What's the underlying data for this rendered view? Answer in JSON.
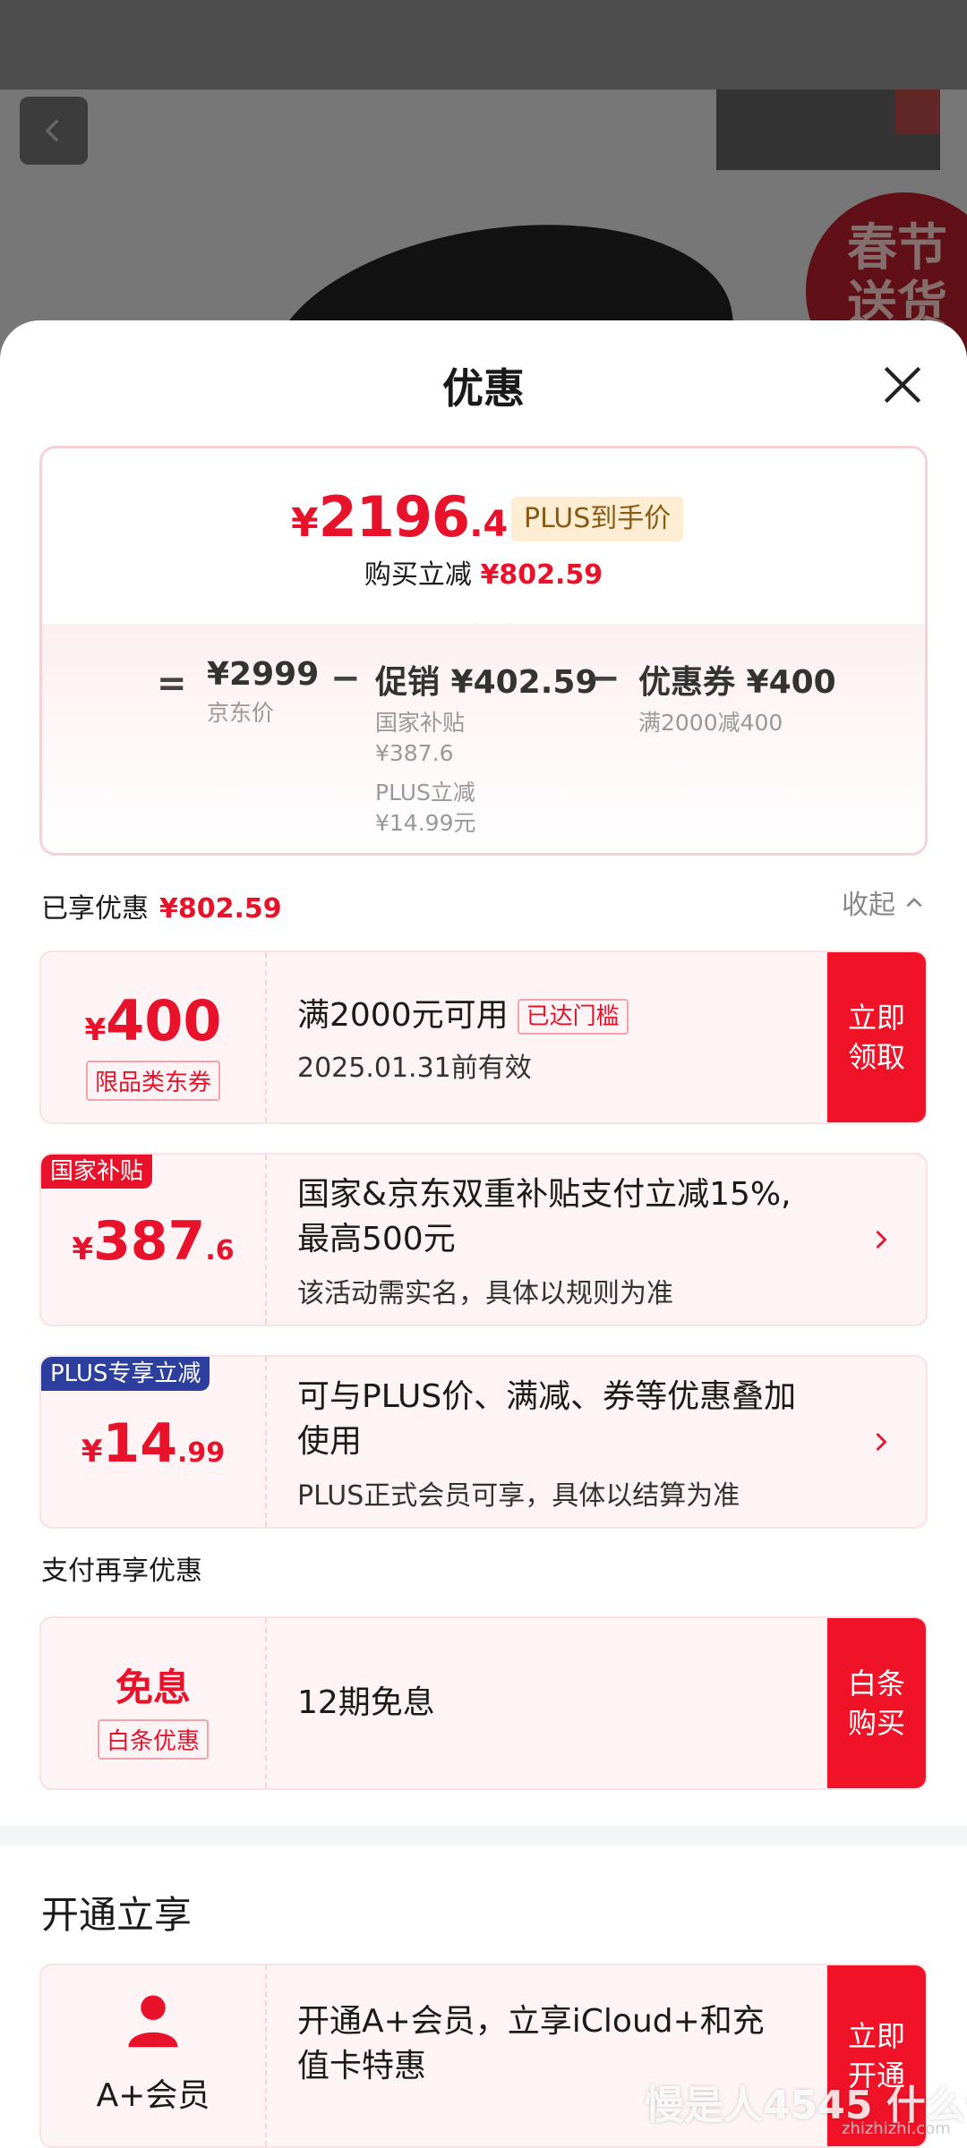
{
  "sheet": {
    "title": "优惠",
    "summary": {
      "final_price": {
        "yen": "¥",
        "int": "2196",
        "dec": ".41"
      },
      "plus_tag": "PLUS到手价",
      "saving_label": "购买立减",
      "saving_value": "¥802.59",
      "eq": "=",
      "minus": "−",
      "jd_price": {
        "value": "¥2999",
        "label": "京东价"
      },
      "promo": {
        "value": "促销 ¥402.59",
        "sub1": "国家补贴",
        "sub1_val": "¥387.6",
        "sub2": "PLUS立减",
        "sub2_val": "¥14.99元"
      },
      "coupon": {
        "value": "优惠券 ¥400",
        "label": "满2000减400"
      }
    },
    "enjoyed": {
      "label": "已享优惠",
      "value": "¥802.59",
      "collapse": "收起"
    },
    "coupons": [
      {
        "yen": "¥",
        "amount": "400",
        "tag": "限品类东券",
        "title": "满2000元可用",
        "badge": "已达门槛",
        "subtitle": "2025.01.31前有效",
        "action": "立即\n领取"
      },
      {
        "corner": "国家补贴",
        "yen": "¥",
        "amount": "387",
        "dec": ".6",
        "title1": "国家&京东双重补贴支付立减15%,",
        "title2": "最高500元",
        "subtitle": "该活动需实名，具体以规则为准"
      },
      {
        "corner": "PLUS专享立减",
        "yen": "¥",
        "amount": "14",
        "dec": ".99",
        "title1": "可与PLUS价、满减、券等优惠叠加",
        "title2": "使用",
        "subtitle": "PLUS正式会员可享，具体以结算为准"
      }
    ],
    "pay_section": "支付再享优惠",
    "pay_card": {
      "label": "免息",
      "tag": "白条优惠",
      "title": "12期免息",
      "action": "白条\n购买"
    },
    "open_section": "开通立享",
    "member_card": {
      "label": "A+会员",
      "title1": "开通A+会员，立享iCloud+和充",
      "title2": "值卡特惠",
      "action": "立即\n开通"
    }
  },
  "background": {
    "badge_text": "春节\n送货"
  },
  "watermark": {
    "text": "慢是人4545 什么值",
    "site": "zhizhizhi.com"
  },
  "colors": {
    "accent": "#e8122a",
    "plus_blue": "#2d3f9e",
    "action_red": "#f01227"
  },
  "icons": [
    "back-icon",
    "close-icon",
    "chevron-up-icon",
    "chevron-right-icon",
    "person-icon"
  ]
}
